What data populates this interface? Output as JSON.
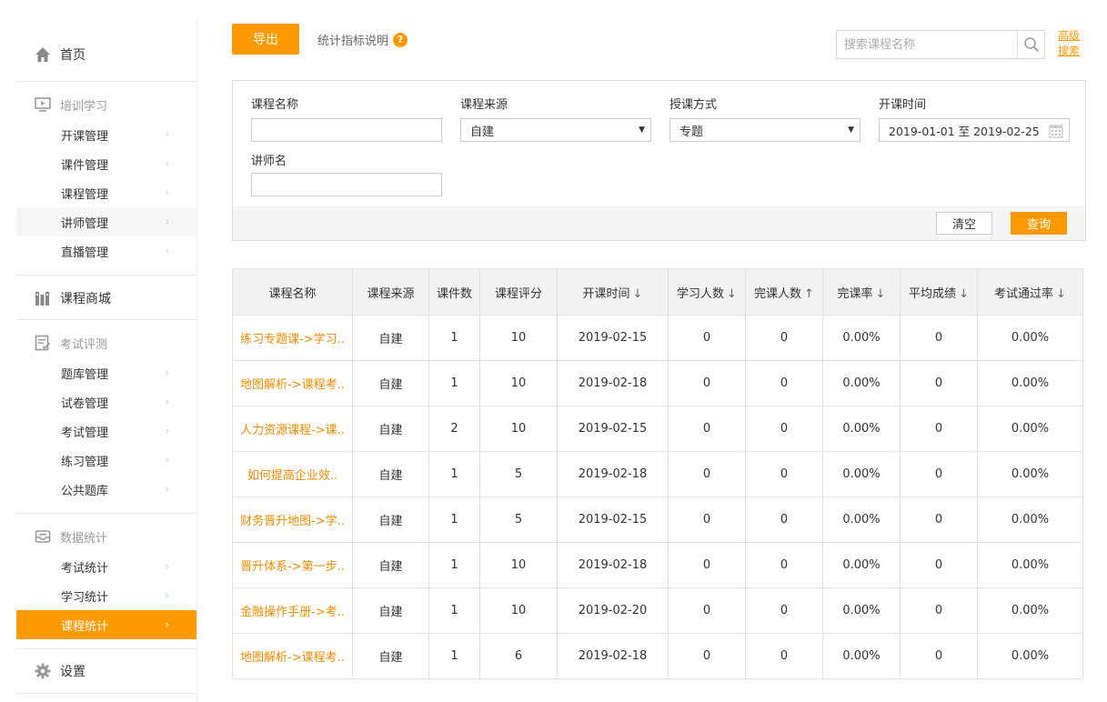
{
  "sidebar": {
    "home": "首页",
    "groups": [
      {
        "title": "培训学习",
        "items": [
          "开课管理",
          "课件管理",
          "课程管理",
          "讲师管理",
          "直播管理"
        ]
      },
      {
        "title": "课程商城",
        "items": []
      },
      {
        "title": "考试评测",
        "items": [
          "题库管理",
          "试卷管理",
          "考试管理",
          "练习管理",
          "公共题库"
        ]
      },
      {
        "title": "数据统计",
        "items": [
          "考试统计",
          "学习统计",
          "课程统计"
        ]
      }
    ],
    "settings": "设置",
    "active_item": "课程统计",
    "hover_item": "讲师管理"
  },
  "toolbar": {
    "export_label": "导出",
    "stat_explain": "统计指标说明",
    "help_mark": "?",
    "search_placeholder": "搜索课程名称",
    "advanced_search": "高级搜索"
  },
  "filter": {
    "course_name_label": "课程名称",
    "course_name_value": "",
    "source_label": "课程来源",
    "source_value": "自建",
    "mode_label": "授课方式",
    "mode_value": "专题",
    "date_label": "开课时间",
    "date_value": "2019-01-01 至 2019-02-25",
    "teacher_label": "讲师名",
    "teacher_value": "",
    "clear_label": "清空",
    "query_label": "查询"
  },
  "table": {
    "columns": [
      "课程名称",
      "课程来源",
      "课件数",
      "课程评分",
      "开课时间",
      "学习人数",
      "完课人数",
      "完课率",
      "平均成绩",
      "考试通过率"
    ],
    "sort_icons": [
      "",
      "",
      "",
      "",
      "↓",
      "↓",
      "↑",
      "↓",
      "↓",
      "↓"
    ],
    "rows": [
      [
        "练习专题课->学习..",
        "自建",
        "1",
        "10",
        "2019-02-15",
        "0",
        "0",
        "0.00%",
        "0",
        "0.00%"
      ],
      [
        "地图解析->课程考..",
        "自建",
        "1",
        "10",
        "2019-02-18",
        "0",
        "0",
        "0.00%",
        "0",
        "0.00%"
      ],
      [
        "人力资源课程->课..",
        "自建",
        "2",
        "10",
        "2019-02-15",
        "0",
        "0",
        "0.00%",
        "0",
        "0.00%"
      ],
      [
        "如何提高企业效..",
        "自建",
        "1",
        "5",
        "2019-02-18",
        "0",
        "0",
        "0.00%",
        "0",
        "0.00%"
      ],
      [
        "财务晋升地图->学..",
        "自建",
        "1",
        "5",
        "2019-02-15",
        "0",
        "0",
        "0.00%",
        "0",
        "0.00%"
      ],
      [
        "晋升体系->第一步..",
        "自建",
        "1",
        "10",
        "2019-02-18",
        "0",
        "0",
        "0.00%",
        "0",
        "0.00%"
      ],
      [
        "金融操作手册->考..",
        "自建",
        "1",
        "10",
        "2019-02-20",
        "0",
        "0",
        "0.00%",
        "0",
        "0.00%"
      ],
      [
        "地图解析->课程考..",
        "自建",
        "1",
        "6",
        "2019-02-18",
        "0",
        "0",
        "0.00%",
        "0",
        "0.00%"
      ]
    ]
  },
  "colors": {
    "accent": "#ff9900",
    "link": "#f08a00"
  }
}
